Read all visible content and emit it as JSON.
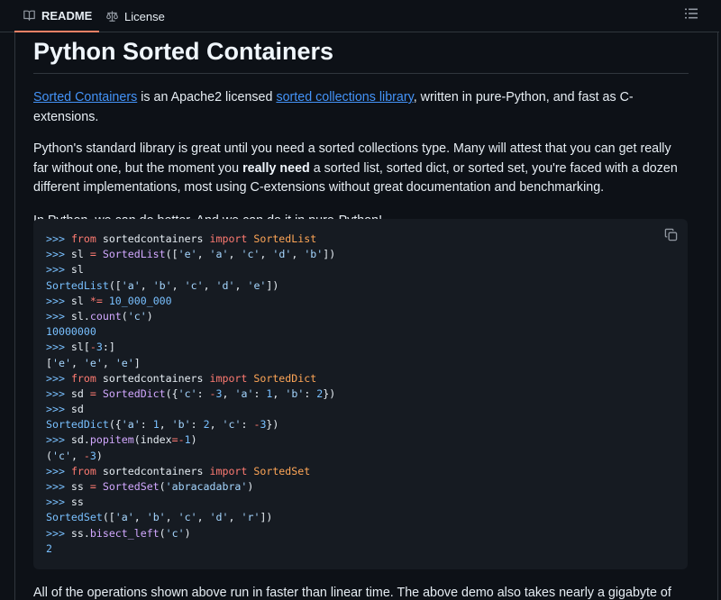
{
  "tabs": [
    {
      "label": "README",
      "icon": "book-icon",
      "active": true
    },
    {
      "label": "License",
      "icon": "law-icon",
      "active": false
    }
  ],
  "outline_icon": "list-icon",
  "colors": {
    "accent_tab": "#f78166",
    "link": "#4493f8",
    "background": "#0d1117",
    "code_background": "#161b22"
  },
  "readme": {
    "title": "Python Sorted Containers",
    "p1": {
      "link1": "Sorted Containers",
      "text1": " is an Apache2 licensed ",
      "link2": "sorted collections library",
      "text2": ", written in pure-Python, and fast as C-extensions."
    },
    "p2": {
      "text1": "Python's standard library is great until you need a sorted collections type. Many will attest that you can get really far without one, but the moment you ",
      "bold": "really need",
      "text2": " a sorted list, sorted dict, or sorted set, you're faced with a dozen different implementations, most using C-extensions without great documentation and benchmarking."
    },
    "p3": "In Python, we can do better. And we can do it in pure-Python!",
    "copy_icon": "copy-icon",
    "code_lines": [
      ">>> from sortedcontainers import SortedList",
      ">>> sl = SortedList(['e', 'a', 'c', 'd', 'b'])",
      ">>> sl",
      "SortedList(['a', 'b', 'c', 'd', 'e'])",
      ">>> sl *= 10_000_000",
      ">>> sl.count('c')",
      "10000000",
      ">>> sl[-3:]",
      "['e', 'e', 'e']",
      ">>> from sortedcontainers import SortedDict",
      ">>> sd = SortedDict({'c': -3, 'a': 1, 'b': 2})",
      ">>> sd",
      "SortedDict({'a': 1, 'b': 2, 'c': -3})",
      ">>> sd.popitem(index=-1)",
      "('c', -3)",
      ">>> from sortedcontainers import SortedSet",
      ">>> ss = SortedSet('abracadabra')",
      ">>> ss",
      "SortedSet(['a', 'b', 'c', 'd', 'r'])",
      ">>> ss.bisect_left('c')",
      "2"
    ],
    "p4": "All of the operations shown above run in faster than linear time. The above demo also takes nearly a gigabyte of"
  }
}
